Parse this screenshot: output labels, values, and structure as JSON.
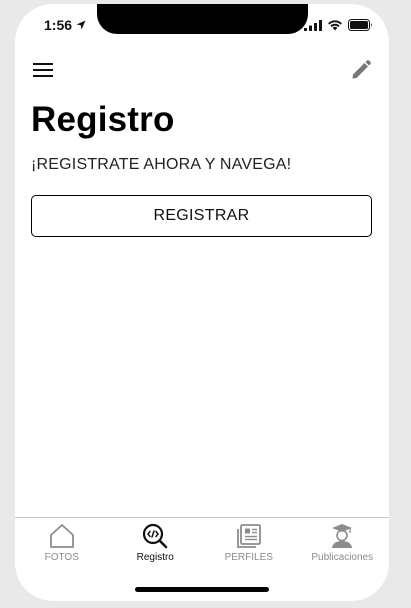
{
  "status_bar": {
    "time": "1:56"
  },
  "header": {
    "menu_icon": "hamburger-menu-icon",
    "edit_icon": "pencil-icon"
  },
  "page": {
    "title": "Registro",
    "subtitle": "¡REGISTRATE AHORA Y NAVEGA!",
    "register_button": "REGISTRAR"
  },
  "tabs": [
    {
      "label": "FOTOS",
      "icon": "home-icon",
      "active": false
    },
    {
      "label": "Registro",
      "icon": "code-search-icon",
      "active": true
    },
    {
      "label": "PERFILES",
      "icon": "profiles-book-icon",
      "active": false
    },
    {
      "label": "Publicaciones",
      "icon": "graduate-avatar-icon",
      "active": false
    }
  ]
}
